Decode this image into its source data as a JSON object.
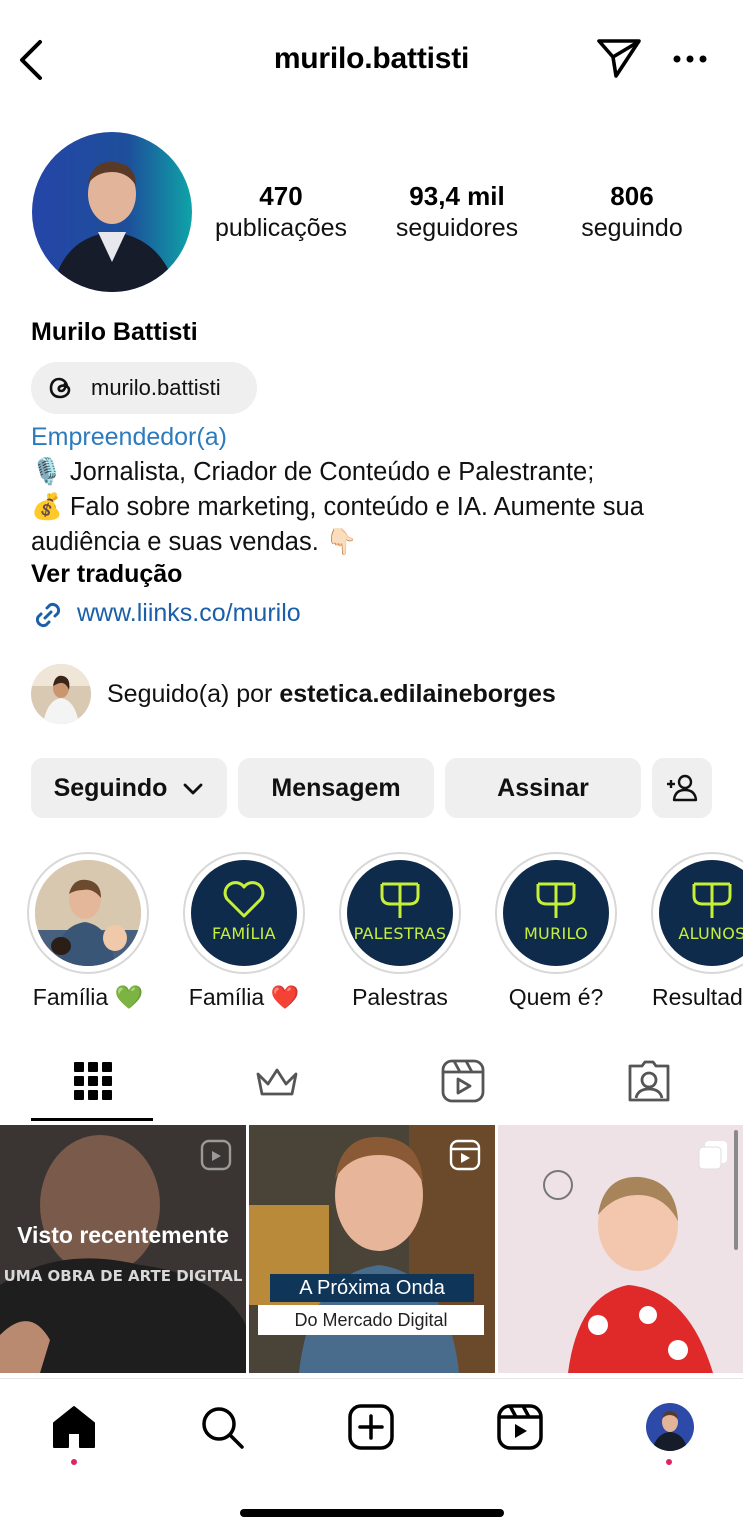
{
  "header": {
    "username": "murilo.battisti",
    "back_icon": "chevron-left-icon",
    "send_icon": "paper-plane-icon",
    "more_icon": "more-horizontal-icon"
  },
  "profile": {
    "stats": [
      {
        "value": "470",
        "label": "publicações"
      },
      {
        "value": "93,4 mil",
        "label": "seguidores"
      },
      {
        "value": "806",
        "label": "seguindo"
      }
    ],
    "name": "Murilo Battisti",
    "threads_handle": "murilo.battisti",
    "category": "Empreendedor(a)",
    "bio_line1": "🎙️ Jornalista, Criador de Conteúdo e Palestrante;",
    "bio_line2": "💰 Falo sobre marketing, conteúdo e IA. Aumente sua audiência e suas vendas. 👇🏻",
    "translate_label": "Ver tradução",
    "link": "www.liinks.co/murilo",
    "followed_by_prefix": "Seguido(a) por ",
    "followed_by_user": "estetica.edilaineborges"
  },
  "actions": {
    "following_label": "Seguindo",
    "message_label": "Mensagem",
    "subscribe_label": "Assinar"
  },
  "highlights": [
    {
      "label": "Família 💚",
      "inner_text": ""
    },
    {
      "label": "Família ❤️",
      "inner_text": "FAMÍLIA"
    },
    {
      "label": "Palestras",
      "inner_text": "PALESTRAS"
    },
    {
      "label": "Quem é?",
      "inner_text": "MURILO"
    },
    {
      "label": "Resultad",
      "inner_text": "ALUNOS"
    }
  ],
  "tabs": [
    "grid-icon",
    "crown-icon",
    "reels-icon",
    "tagged-icon"
  ],
  "posts": {
    "first_overlay": "Visto recentemente",
    "first_caption_bg": "UMA OBRA DE ARTE DIGITAL",
    "second_caption_line1": "A Próxima Onda",
    "second_caption_line2": "Do Mercado Digital"
  },
  "bottom_nav": [
    "home-icon",
    "search-icon",
    "create-icon",
    "reels-icon",
    "profile-avatar"
  ],
  "colors": {
    "accent_link": "#1a5fa8",
    "category": "#2c7bbf",
    "highlight_bg": "#0f2b4c",
    "highlight_text": "#c6ef3a",
    "notification_dot": "#e0245e"
  }
}
